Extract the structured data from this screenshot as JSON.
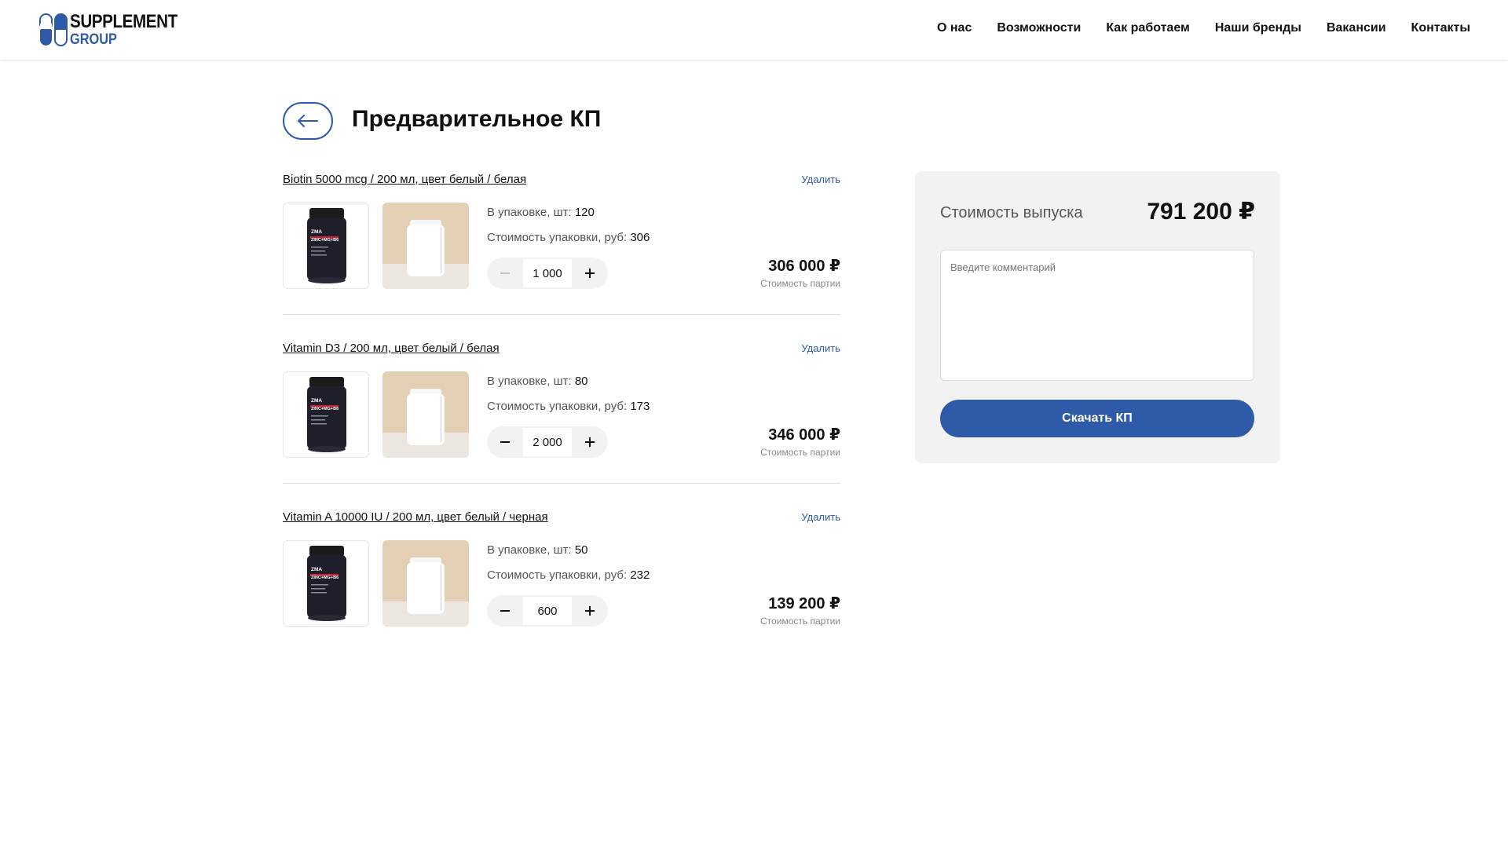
{
  "brand": {
    "line1": "SUPPLEMENT",
    "line2": "GROUP",
    "accent_color": "#2f5aa8"
  },
  "nav": [
    {
      "label": "О нас"
    },
    {
      "label": "Возможности"
    },
    {
      "label": "Как работаем"
    },
    {
      "label": "Наши бренды"
    },
    {
      "label": "Вакансии"
    },
    {
      "label": "Контакты"
    }
  ],
  "page": {
    "back_icon": "arrow-left-icon",
    "title": "Предварительное КП"
  },
  "items": [
    {
      "name": "Biotin 5000 mcg / 200 мл, цвет белый / белая",
      "delete_label": "Удалить",
      "pack_qty_label": "В упаковке, шт:",
      "pack_qty": "120",
      "pack_cost_label": "Стоимость упаковки, руб:",
      "pack_cost": "306",
      "quantity": "1 000",
      "minus_disabled": true,
      "price": "306 000 ₽",
      "price_label": "Стоимость партии"
    },
    {
      "name": "Vitamin D3 / 200 мл, цвет белый / белая",
      "delete_label": "Удалить",
      "pack_qty_label": "В упаковке, шт:",
      "pack_qty": "80",
      "pack_cost_label": "Стоимость упаковки, руб:",
      "pack_cost": "173",
      "quantity": "2 000",
      "minus_disabled": false,
      "price": "346 000 ₽",
      "price_label": "Стоимость партии"
    },
    {
      "name": "Vitamin A 10000 IU /  200 мл, цвет белый / черная",
      "delete_label": "Удалить",
      "pack_qty_label": "В упаковке, шт:",
      "pack_qty": "50",
      "pack_cost_label": "Стоимость упаковки, руб:",
      "pack_cost": "232",
      "quantity": "600",
      "minus_disabled": false,
      "price": "139 200 ₽",
      "price_label": "Стоимость партии"
    }
  ],
  "summary": {
    "label": "Стоимость выпуска",
    "value": "791 200 ₽",
    "comment_placeholder": "Введите комментарий",
    "download_label": "Скачать КП"
  },
  "product_image_text": {
    "line1": "ZMA",
    "line2": "ZINC+MG+B6"
  }
}
